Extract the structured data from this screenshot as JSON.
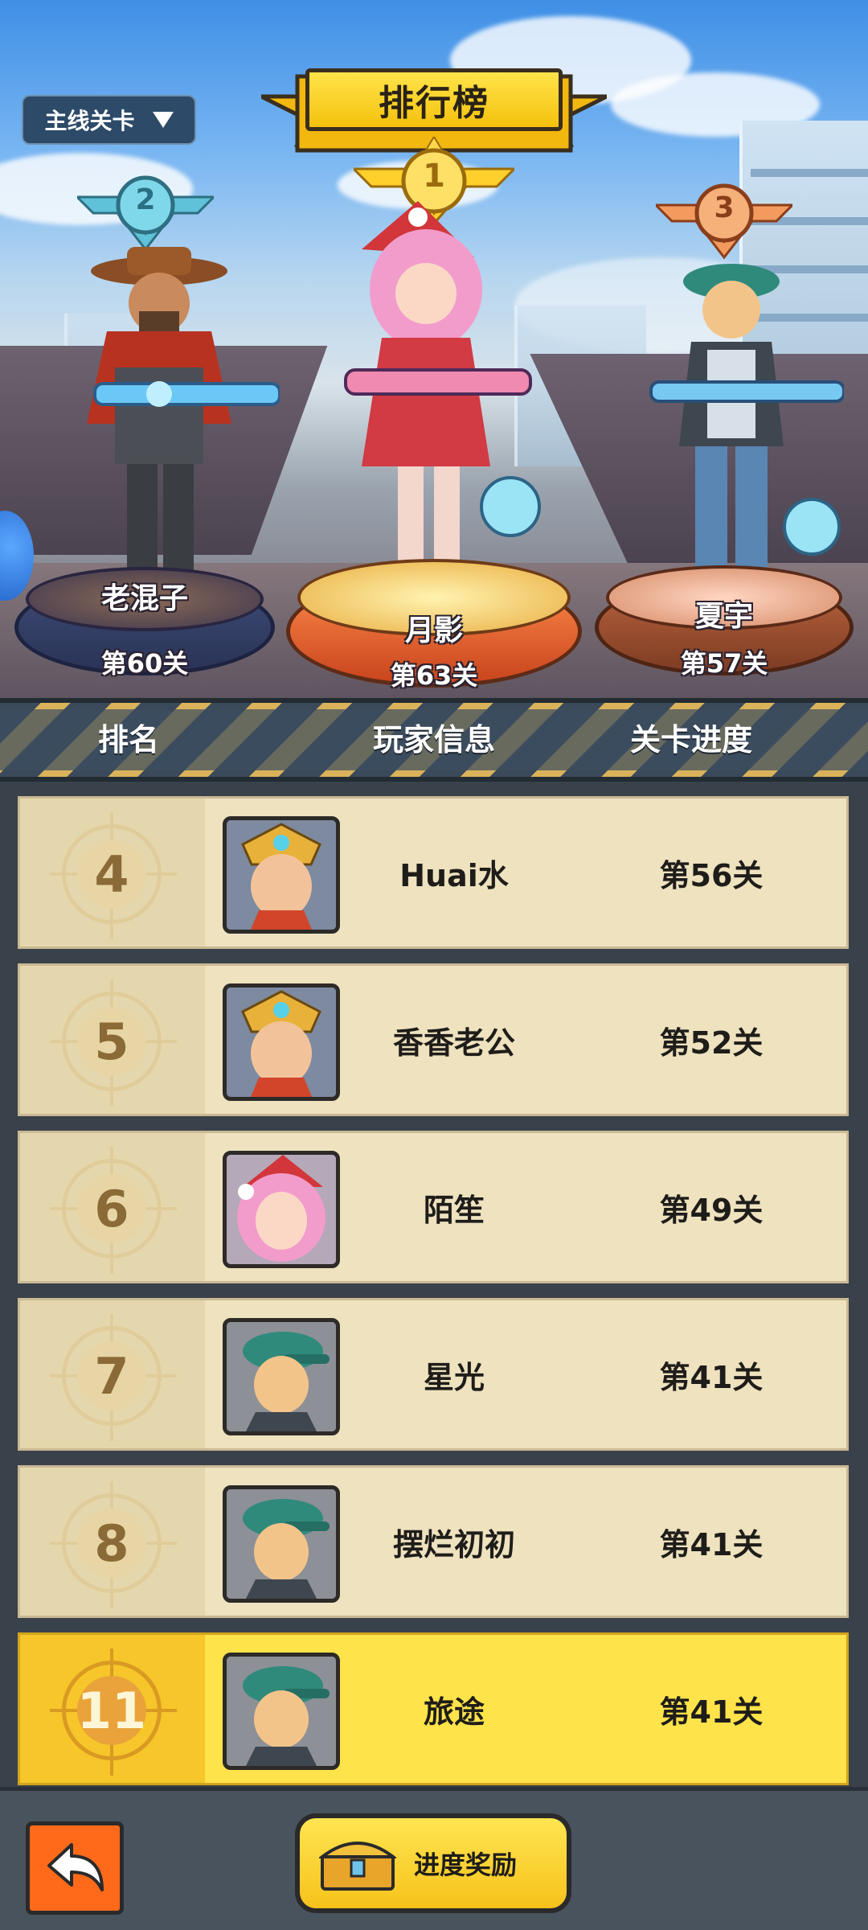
{
  "mode_selector": {
    "label": "主线关卡"
  },
  "title": "排行榜",
  "podium": [
    {
      "rank": "2",
      "name": "老混子",
      "level": "第60关"
    },
    {
      "rank": "1",
      "name": "月影",
      "level": "第63关"
    },
    {
      "rank": "3",
      "name": "夏宇",
      "level": "第57关"
    }
  ],
  "list_header": {
    "rank": "排名",
    "player": "玩家信息",
    "progress": "关卡进度"
  },
  "rows": [
    {
      "rank": "4",
      "name": "Huai水",
      "level": "第56关",
      "avatar": "gold-helmet"
    },
    {
      "rank": "5",
      "name": "香香老公",
      "level": "第52关",
      "avatar": "gold-helmet"
    },
    {
      "rank": "6",
      "name": "陌笙",
      "level": "第49关",
      "avatar": "pink-hair"
    },
    {
      "rank": "7",
      "name": "星光",
      "level": "第41关",
      "avatar": "green-cap"
    },
    {
      "rank": "8",
      "name": "摆烂初初",
      "level": "第41关",
      "avatar": "green-cap"
    },
    {
      "rank": "11",
      "name": "旅途",
      "level": "第41关",
      "avatar": "green-cap",
      "is_self": true
    }
  ],
  "bottom": {
    "reward_label": "进度奖励",
    "back_icon": "back-arrow-icon",
    "reward_icon": "treasure-chest-icon"
  },
  "colors": {
    "accent_yellow": "#ffe34b",
    "back_orange": "#ff6a1a",
    "row_bg": "#eee2bf"
  }
}
